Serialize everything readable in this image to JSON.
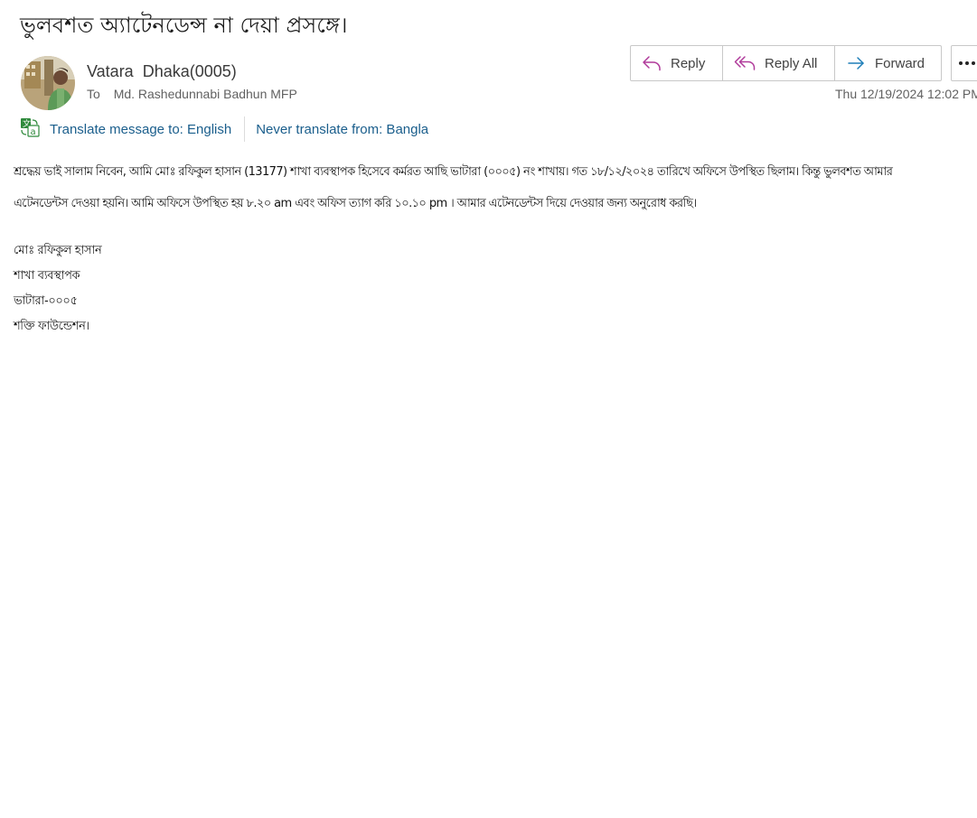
{
  "email": {
    "subject": "ভুলবশত অ্যাটেনডেন্স না দেয়া প্রসঙ্গে।",
    "sender_name": "Vatara  Dhaka(0005)",
    "to_label": "To",
    "recipient": "Md. Rashedunnabi Badhun MFP",
    "timestamp": "Thu 12/19/2024 12:02 PM"
  },
  "actions": {
    "reply": "Reply",
    "reply_all": "Reply All",
    "forward": "Forward",
    "more_icon": "more-horizontal-icon"
  },
  "translate": {
    "icon": "translate-icon",
    "translate_link": "Translate message to: English",
    "never_link": "Never translate from: Bangla"
  },
  "body": {
    "line1": "শ্রদ্ধেয় ভাই সালাম নিবেন, আমি মোঃ রফিকুল হাসান (13177) শাখা ব্যবস্থাপক হিসেবে কর্মরত আছি ভাটারা (০০০৫) নং শাখায়। গত ১৮/১২/২০২৪ তারিখে অফিসে উপস্থিত ছিলাম। কিন্তু ভুলবশত আমার",
    "line2": "এটেনডেন্টস দেওয়া হয়নি। আমি অফিসে উপস্থিত হয় ৮.২০ am এবং অফিস ত্যাগ করি ১০.১০ pm । আমার এটেনডেন্টস দিয়ে দেওয়ার জন্য অনুরোধ করছি।"
  },
  "signature": {
    "name": "মোঃ রফিকুল হাসান",
    "title": "শাখা ব্যবস্থাপক",
    "branch": "ভাটারা-০০০৫",
    "org": "শক্তি ফাউন্ডেশন।"
  },
  "colors": {
    "link": "#1a5e8c",
    "reply_icon": "#b03a9a",
    "forward_icon": "#1f7fb8"
  }
}
